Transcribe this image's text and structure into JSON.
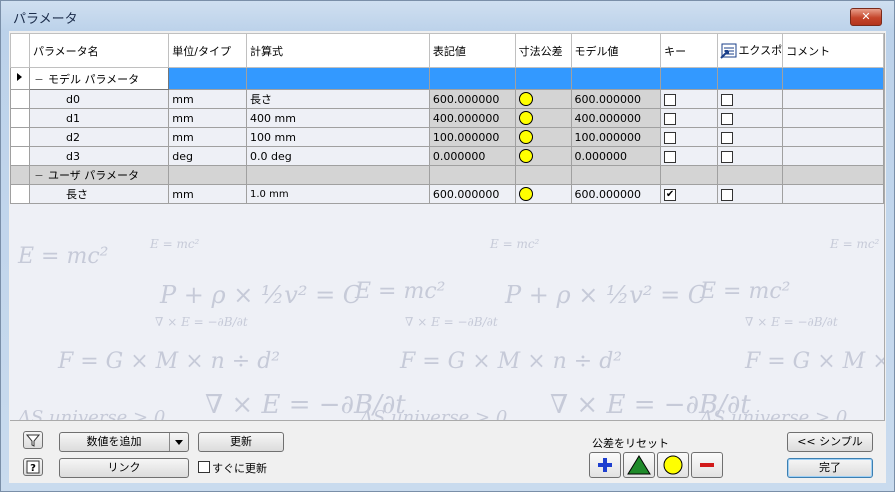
{
  "window": {
    "title": "パラメータ",
    "close_label": "✕"
  },
  "columns": [
    "パラメータ名",
    "単位/タイプ",
    "計算式",
    "表記値",
    "寸法公差",
    "モデル値",
    "キー",
    "エクスポ",
    "コメント"
  ],
  "groups": [
    {
      "name": "モデル パラメータ",
      "rows": [
        {
          "name": "d0",
          "unit": "mm",
          "formula": "長さ",
          "nominal": "600.000000",
          "model": "600.000000",
          "key": false,
          "export": false
        },
        {
          "name": "d1",
          "unit": "mm",
          "formula": "400 mm",
          "nominal": "400.000000",
          "model": "400.000000",
          "key": false,
          "export": false
        },
        {
          "name": "d2",
          "unit": "mm",
          "formula": "100 mm",
          "nominal": "100.000000",
          "model": "100.000000",
          "key": false,
          "export": false
        },
        {
          "name": "d3",
          "unit": "deg",
          "formula": "0.0 deg",
          "nominal": "0.000000",
          "model": "0.000000",
          "key": false,
          "export": false
        }
      ]
    },
    {
      "name": "ユーザ パラメータ",
      "rows": [
        {
          "name": "長さ",
          "unit": "mm",
          "formula": "1.0 mm",
          "nominal": "600.000000",
          "model": "600.000000",
          "key": true,
          "export": false
        }
      ]
    }
  ],
  "background_formulas": [
    "E = mc²",
    "P + ρ × ½v² = C",
    "∇ × E = −∂B/∂t",
    "ΔS universe > 0",
    "F = G × M × n ÷ d²"
  ],
  "toolbar": {
    "add_value": "数値を追加",
    "update": "更新",
    "link": "リンク",
    "immediate_update": "すぐに更新",
    "reset_tolerance": "公差をリセット",
    "simple": "<< シンプル",
    "done": "完了"
  },
  "colors": {
    "selection": "#3399ff",
    "tolerance_circle": "#ffff00",
    "plus": "#1e3fcf",
    "triangle": "#1f8a2a",
    "minus": "#d11a1a"
  }
}
